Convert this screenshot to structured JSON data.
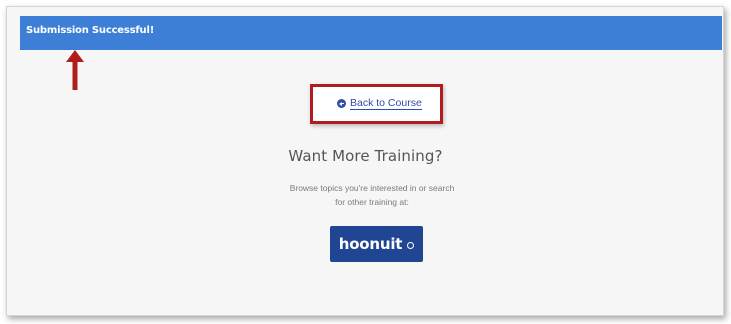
{
  "banner": {
    "title": "Submission Successful!",
    "color": "#3d7fd6"
  },
  "back_link": {
    "icon": "arrow-circle-left-icon",
    "label": "Back to Course"
  },
  "promo": {
    "heading": "Want More Training?",
    "line1": "Browse topics you're interested in or search",
    "line2": "for other training at:"
  },
  "logo": {
    "text": "hoonuit",
    "color": "#1f4593"
  },
  "annotations": {
    "arrow_color": "#b11d1d",
    "highlight_color": "#b11d1d"
  }
}
